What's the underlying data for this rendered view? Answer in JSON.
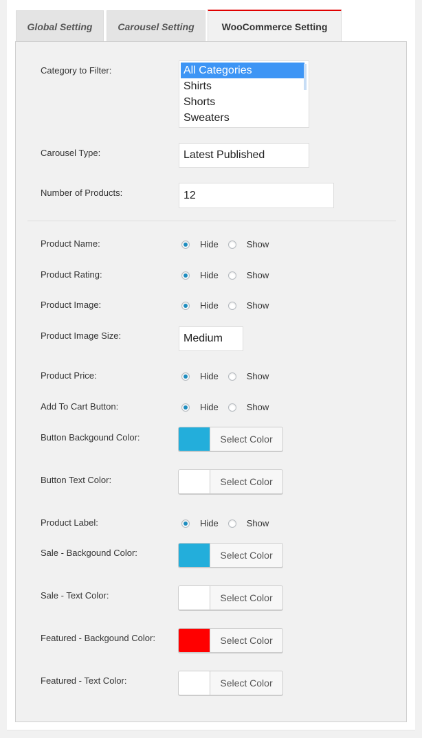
{
  "tabs": [
    {
      "label": "Global Setting"
    },
    {
      "label": "Carousel Setting"
    },
    {
      "label": "WooCommerce Setting"
    }
  ],
  "category": {
    "label": "Category to Filter:",
    "options": [
      "All Categories",
      "Shirts",
      "Shorts",
      "Sweaters"
    ],
    "selected": "All Categories"
  },
  "carousel_type": {
    "label": "Carousel Type:",
    "value": "Latest Published"
  },
  "num_products": {
    "label": "Number of Products:",
    "value": "12"
  },
  "radio_labels": {
    "hide": "Hide",
    "show": "Show"
  },
  "product_name": {
    "label": "Product Name:",
    "selected": "Hide"
  },
  "product_rating": {
    "label": "Product Rating:",
    "selected": "Hide"
  },
  "product_image": {
    "label": "Product Image:",
    "selected": "Hide"
  },
  "image_size": {
    "label": "Product Image Size:",
    "value": "Medium"
  },
  "product_price": {
    "label": "Product Price:",
    "selected": "Hide"
  },
  "add_to_cart": {
    "label": "Add To Cart Button:",
    "selected": "Hide"
  },
  "select_color_label": "Select Color",
  "button_bg": {
    "label": "Button Backgound Color:",
    "color": "#23aedb"
  },
  "button_text": {
    "label": "Button Text Color:",
    "color": "#ffffff"
  },
  "product_label": {
    "label": "Product Label:",
    "selected": "Hide"
  },
  "sale_bg": {
    "label": "Sale - Backgound Color:",
    "color": "#23aedb"
  },
  "sale_text": {
    "label": "Sale - Text Color:",
    "color": "#ffffff"
  },
  "featured_bg": {
    "label": "Featured - Backgound Color:",
    "color": "#ff0000"
  },
  "featured_text": {
    "label": "Featured - Text Color:",
    "color": "#ffffff"
  },
  "colors": {
    "active_tab_accent": "#e00000",
    "selected_option": "#3d95f5",
    "radio_dot": "#1e8cbe"
  }
}
